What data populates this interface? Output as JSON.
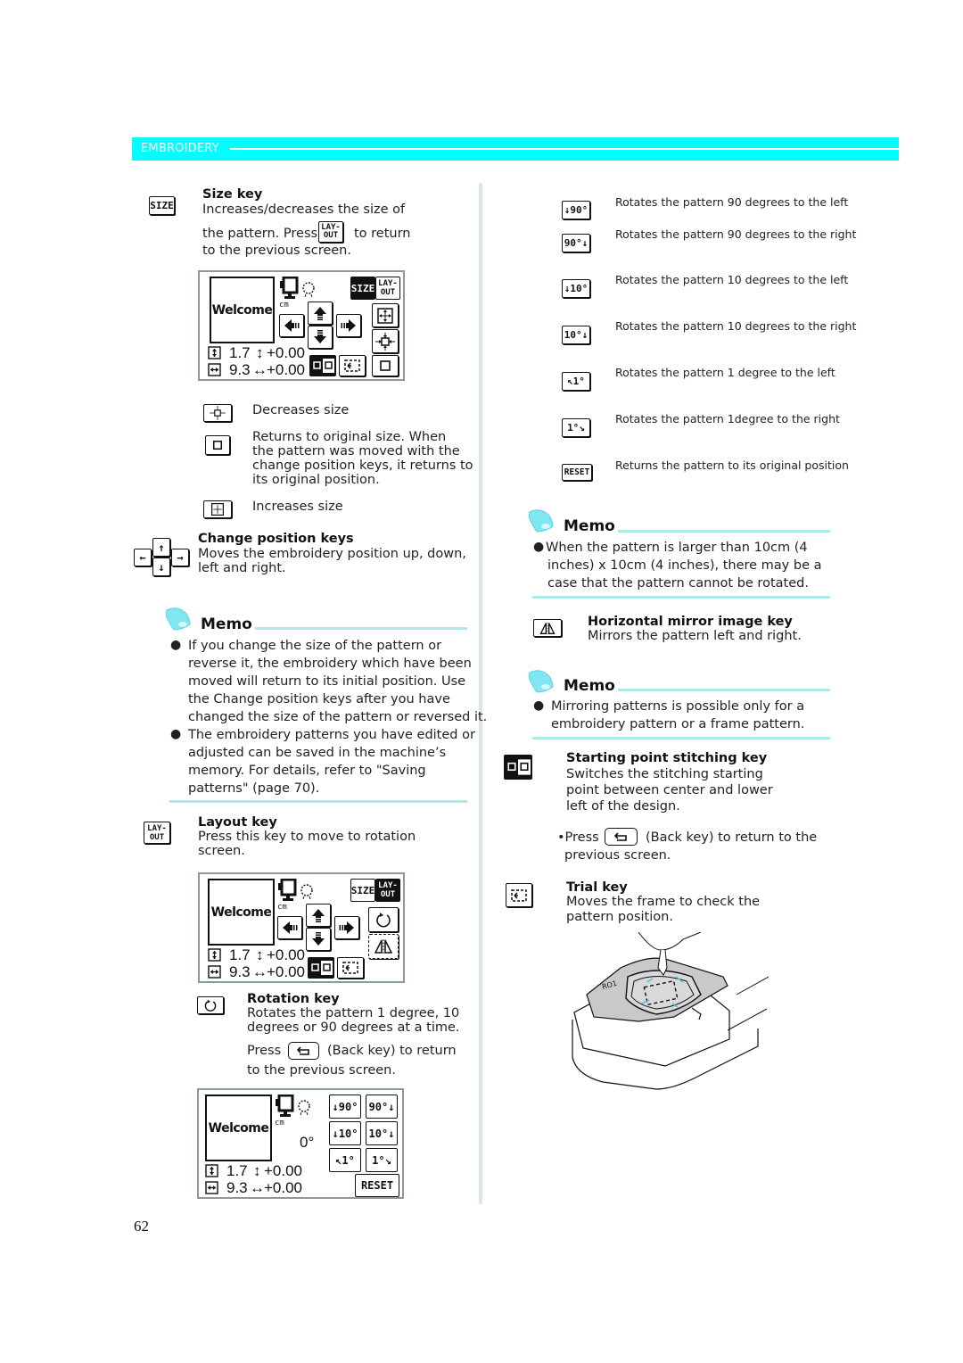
{
  "header": {
    "section_label": "EMBROIDERY",
    "band_color": "#00ffff",
    "memo_rule_color": "#a8ecea",
    "memo_icon_color": "#7fe6f2"
  },
  "left": {
    "size_key": {
      "icon": "SIZE",
      "title": "Size key",
      "line1": "Increases/decreases the size of",
      "line2a": "the pattern. Press",
      "layout_icon_top": "LAY-",
      "layout_icon_bottom": "OUT",
      "line2b": "to return",
      "line3": "to the previous screen."
    },
    "screen1": {
      "welcome": "Welcome",
      "unit": "cm",
      "size_label": "SIZE",
      "layout_top": "LAY-",
      "layout_bottom": "OUT",
      "height_value": "1.7",
      "height_offset": "+0.00",
      "width_value": "9.3",
      "width_offset": "+0.00"
    },
    "size_buttons": [
      {
        "icon": "decrease-size-icon",
        "text": "Decreases size"
      },
      {
        "icon": "original-size-icon",
        "text_lines": [
          "Returns to original size. When",
          "the pattern was moved with the",
          "change position keys, it returns to",
          "its original position."
        ]
      },
      {
        "icon": "increase-size-icon",
        "text": "Increases size"
      }
    ],
    "change_position": {
      "title": "Change position keys",
      "line1": "Moves the embroidery position up, down,",
      "line2": "left and right."
    },
    "memo1": {
      "title": "Memo",
      "bullets": [
        [
          "If you change the size of the pattern or",
          "reverse it, the embroidery which have been",
          "moved will return to its initial position. Use",
          "the Change position keys after you have",
          "changed the size of the pattern or reversed it."
        ],
        [
          "The embroidery patterns you have edited or",
          "adjusted can be saved in the machine’s",
          "memory. For details, refer to \"Saving",
          "patterns\" (page 70)."
        ]
      ]
    },
    "layout_key": {
      "icon_top": "LAY-",
      "icon_bottom": "OUT",
      "title": "Layout key",
      "line1": "Press this key to move to rotation",
      "line2": "screen."
    },
    "screen2": {
      "welcome": "Welcome",
      "unit": "cm",
      "size_label": "SIZE",
      "layout_top": "LAY-",
      "layout_bottom": "OUT",
      "height_value": "1.7",
      "height_offset": "+0.00",
      "width_value": "9.3",
      "width_offset": "+0.00"
    },
    "rotation_key": {
      "title": "Rotation key",
      "line1": "Rotates the pattern 1 degree, 10",
      "line2": "degrees or 90 degrees at a time.",
      "press": "Press",
      "back": "(Back key) to return",
      "line4": "to the previous screen."
    },
    "screen3": {
      "welcome": "Welcome",
      "unit": "cm",
      "angle": "0°",
      "height_value": "1.7",
      "height_offset": "+0.00",
      "width_value": "9.3",
      "width_offset": "+0.00",
      "reset": "RESET",
      "rot_buttons": [
        "↓90°",
        "90°↓",
        "↓10°",
        "10°↓",
        "↖1°",
        "1°↘"
      ]
    },
    "page_number": "62"
  },
  "right": {
    "rotations": [
      {
        "icon": "↓90°",
        "text": "Rotates the pattern 90 degrees to the left"
      },
      {
        "icon": "90°↓",
        "text": "Rotates the pattern 90 degrees to the right"
      },
      {
        "icon": "↓10°",
        "text": "Rotates the pattern 10 degrees to the left"
      },
      {
        "icon": "10°↓",
        "text": "Rotates the pattern 10 degrees to the right"
      },
      {
        "icon": "↖1°",
        "text": "Rotates the pattern 1 degree to the left"
      },
      {
        "icon": "1°↘",
        "text": "Rotates the pattern 1degree to the right"
      },
      {
        "icon": "RESET",
        "text": "Returns the pattern to its original position"
      }
    ],
    "memo2": {
      "title": "Memo",
      "lines": [
        "When the pattern is larger than 10cm (4",
        "inches) x 10cm (4 inches), there may be a",
        "case that the pattern cannot be rotated."
      ]
    },
    "mirror_key": {
      "title": "Horizontal mirror image key",
      "line1": "Mirrors the pattern left and right."
    },
    "memo3": {
      "title": "Memo",
      "lines": [
        "Mirroring patterns is possible only for a",
        "embroidery pattern or a frame pattern."
      ]
    },
    "start_point_key": {
      "title": "Starting point stitching key",
      "lines": [
        "Switches the stitching starting",
        "point between center and lower",
        "left of the design."
      ],
      "press": "•Press",
      "back": "(Back key) to return to the",
      "line_last": "previous screen."
    },
    "trial_key": {
      "title": "Trial key",
      "line1": "Moves the frame to check the",
      "line2": "pattern position."
    }
  }
}
